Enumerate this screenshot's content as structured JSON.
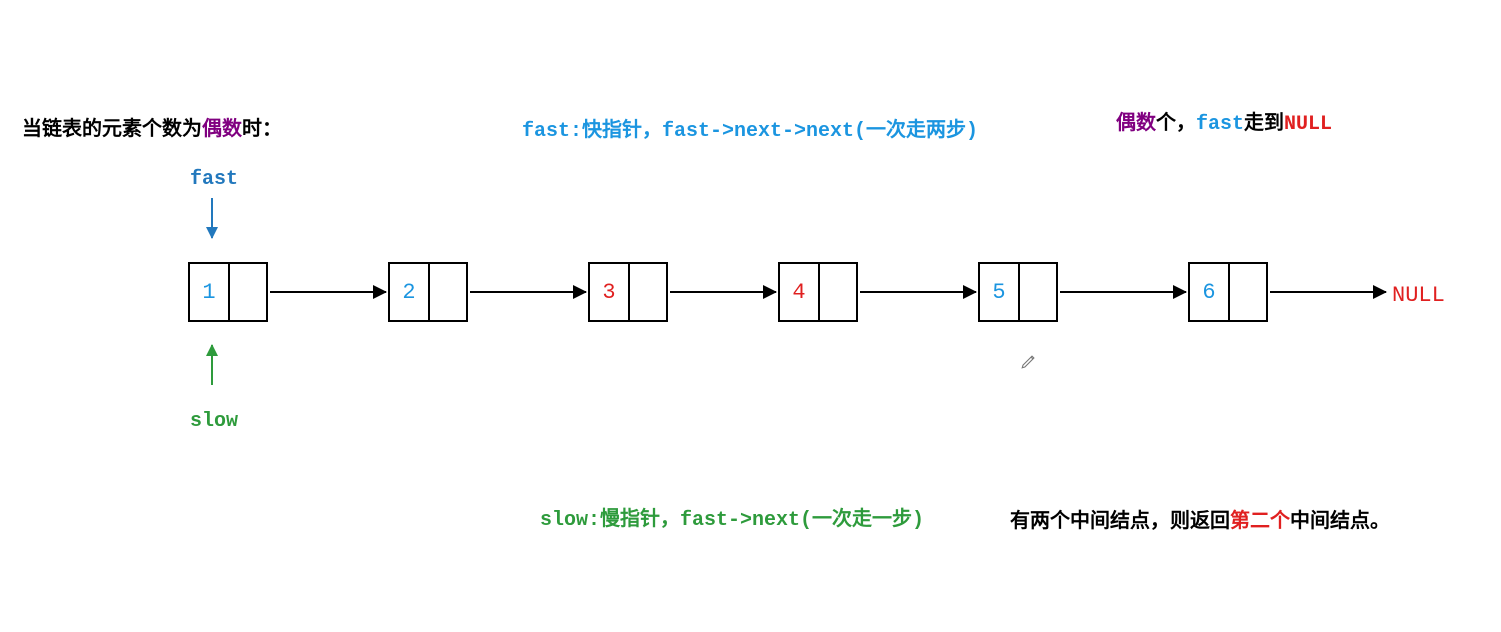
{
  "title": {
    "prefix": "当链表的元素个数为",
    "highlight": "偶数",
    "suffix": "时："
  },
  "fast_desc": {
    "p1": "fast:快指针，fast->next->next(一次走两步)"
  },
  "even_note": {
    "p1": "偶数",
    "p2": "个，",
    "p3": "fast",
    "p4": "走到",
    "p5": "NULL"
  },
  "fast_label": "fast",
  "slow_label": "slow",
  "nodes": [
    {
      "val": "1",
      "color": "#1b95e0"
    },
    {
      "val": "2",
      "color": "#1b95e0"
    },
    {
      "val": "3",
      "color": "#e02020"
    },
    {
      "val": "4",
      "color": "#e02020"
    },
    {
      "val": "5",
      "color": "#1b95e0"
    },
    {
      "val": "6",
      "color": "#1b95e0"
    }
  ],
  "null_label": "NULL",
  "slow_desc": "slow:慢指针，fast->next(一次走一步)",
  "return_note": {
    "p1": "有两个中间结点，则返回",
    "p2": "第二个",
    "p3": "中间结点。"
  },
  "chart_data": {
    "type": "diagram",
    "structure": "singly-linked-list",
    "nodes": [
      1,
      2,
      3,
      4,
      5,
      6
    ],
    "terminator": "NULL",
    "pointers": {
      "fast": 1,
      "slow": 1
    },
    "highlight_nodes": [
      3,
      4
    ],
    "annotations": {
      "fast": "fast->next->next (two steps per move)",
      "slow": "fast->next (one step per move)",
      "even_rule": "when even count, fast reaches NULL",
      "return_rule": "if two middle nodes, return the second one"
    }
  }
}
